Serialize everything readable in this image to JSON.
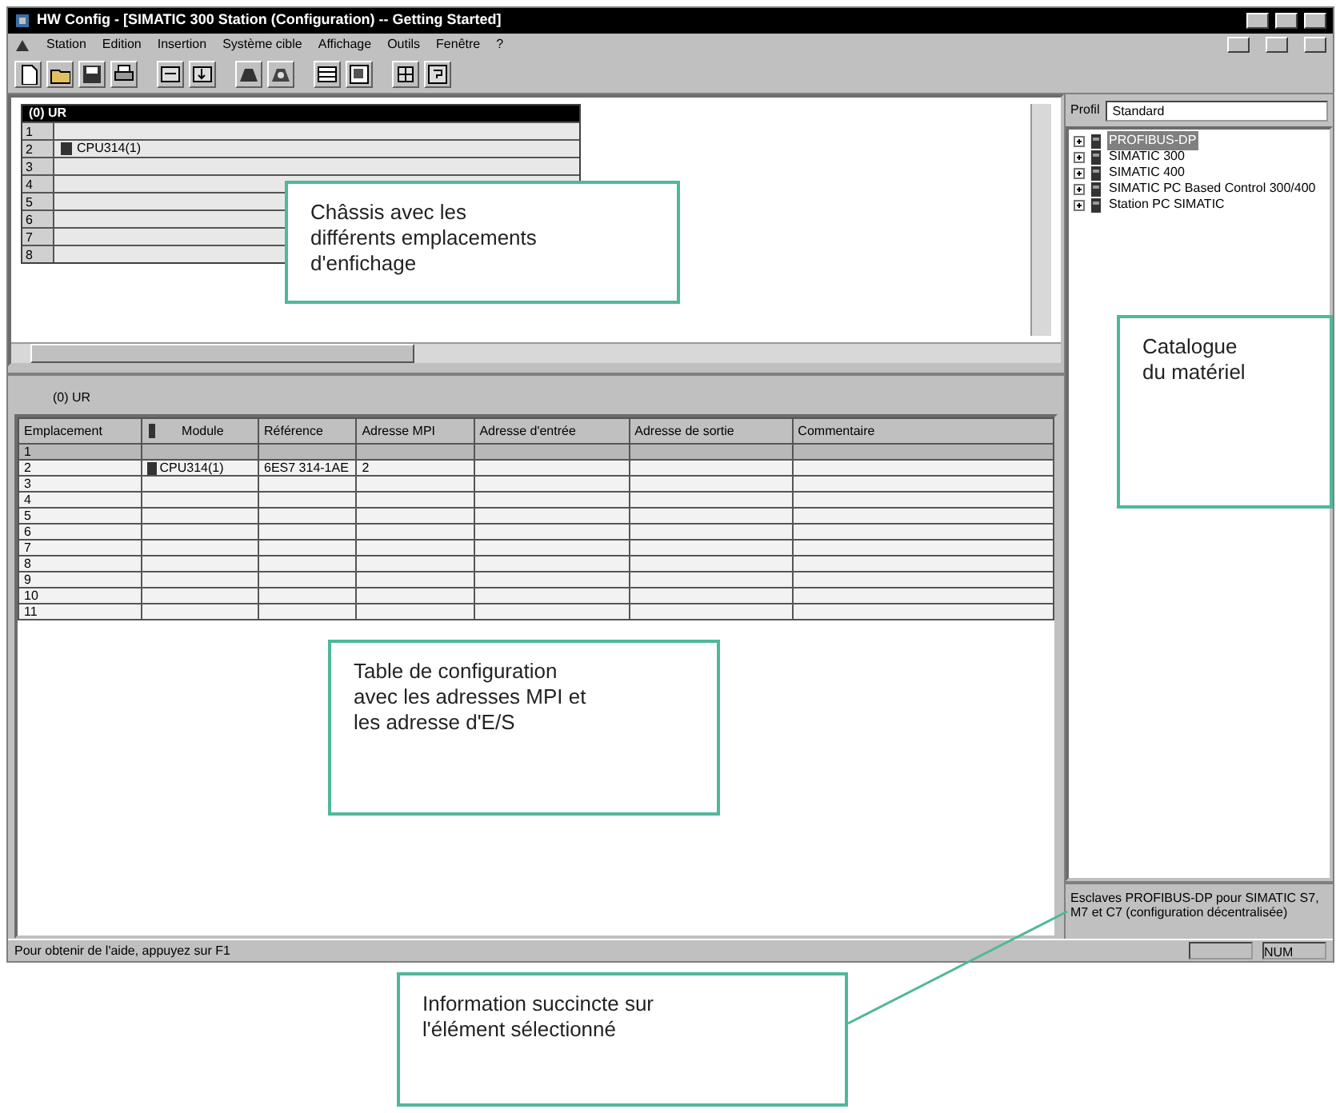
{
  "window": {
    "title": "HW Config - [SIMATIC 300 Station (Configuration) -- Getting Started]"
  },
  "menu": [
    "Station",
    "Edition",
    "Insertion",
    "Système cible",
    "Affichage",
    "Outils",
    "Fenêtre",
    "?"
  ],
  "rack": {
    "title": "(0) UR",
    "slots": [
      {
        "number": "1"
      },
      {
        "number": "2",
        "module": "CPU314(1)"
      },
      {
        "number": "3"
      },
      {
        "number": "4"
      },
      {
        "number": "5"
      },
      {
        "number": "6"
      },
      {
        "number": "7"
      },
      {
        "number": "8"
      }
    ]
  },
  "config_table": {
    "label": "(0) UR",
    "columns": [
      "Emplacement",
      "Module",
      "Référence",
      "Adresse MPI",
      "Adresse d'entrée",
      "Adresse de sortie",
      "Commentaire"
    ],
    "rows": [
      {
        "slot": "1",
        "selected": true
      },
      {
        "slot": "2",
        "module": "CPU314(1)",
        "reference": "6ES7 314-1AE",
        "mpi": "2",
        "selected": false
      },
      {
        "slot": "3",
        "selected": false
      },
      {
        "slot": "4",
        "selected": false
      },
      {
        "slot": "5",
        "selected": false
      },
      {
        "slot": "6",
        "selected": false
      },
      {
        "slot": "7",
        "selected": false
      },
      {
        "slot": "8",
        "selected": false
      },
      {
        "slot": "9",
        "selected": false
      },
      {
        "slot": "10",
        "selected": false
      },
      {
        "slot": "11",
        "selected": false
      }
    ]
  },
  "catalog": {
    "profile_label": "Profil",
    "profile_value": "Standard",
    "items": [
      {
        "label": "PROFIBUS-DP",
        "selected": true
      },
      {
        "label": "SIMATIC 300",
        "selected": false
      },
      {
        "label": "SIMATIC 400",
        "selected": false
      },
      {
        "label": "SIMATIC PC Based Control 300/400",
        "selected": false
      },
      {
        "label": "Station PC SIMATIC",
        "selected": false
      }
    ],
    "info": "Esclaves PROFIBUS-DP pour SIMATIC S7, M7 et C7 (configuration décentralisée)"
  },
  "status_bar": {
    "text": "Pour obtenir de l'aide, appuyez sur F1",
    "indicator": "NUM"
  },
  "callouts": [
    {
      "text": "Châssis avec les\ndifférents emplacements\nd'enfichage"
    },
    {
      "text": "Catalogue\ndu matériel"
    },
    {
      "text": "Table de configuration\navec les adresses MPI et\nles adresse d'E/S"
    },
    {
      "text": "Information succincte sur\nl'élément sélectionné"
    }
  ]
}
